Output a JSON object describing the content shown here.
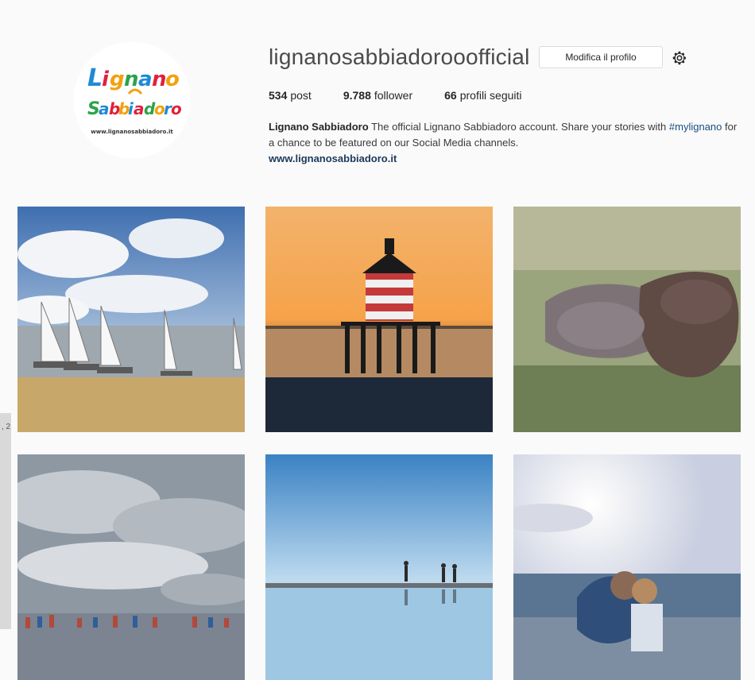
{
  "profile": {
    "username": "lignanosabbiadorooofficial",
    "edit_label": "Modifica il profilo",
    "logo": {
      "line1": "Lignano",
      "line2": "Sabbiadoro",
      "site": "www.lignanosabbiadoro.it"
    },
    "stats": [
      {
        "value": "534",
        "label": "post"
      },
      {
        "value": "9.788",
        "label": "follower"
      },
      {
        "value": "66",
        "label": "profili seguiti"
      }
    ],
    "bio": {
      "name": "Lignano Sabbiadoro",
      "text_a": "The official Lignano Sabbiadoro account. Share your stories with",
      "hashtag": "#mylignano",
      "text_b": "for a chance to be featured on our Social Media channels.",
      "website": "www.lignanosabbiadoro.it"
    }
  },
  "icons": {
    "settings": "gear-icon"
  },
  "side_text": ", 2"
}
